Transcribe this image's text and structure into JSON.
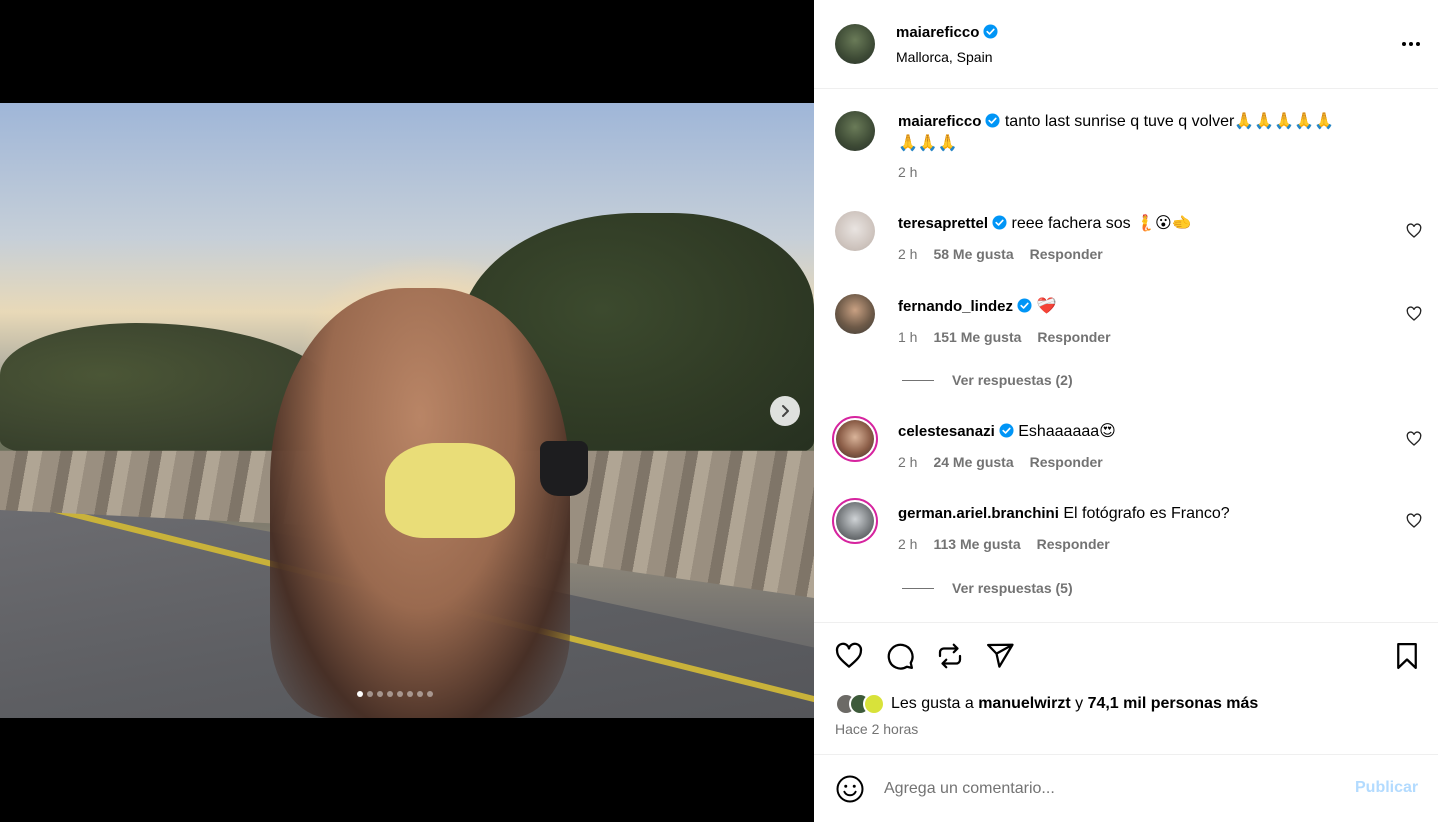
{
  "post": {
    "author": "maiareficco",
    "location": "Mallorca, Spain",
    "carousel": {
      "total_slides": 8,
      "active_index": 0
    }
  },
  "caption": {
    "author": "maiareficco",
    "text": "tanto last sunrise q tuve q volver🙏🙏🙏🙏🙏",
    "text_line2": "🙏🙏🙏",
    "time": "2 h"
  },
  "comments": [
    {
      "author": "teresaprettel",
      "text": "reee fachera sos 🧜😮🫲",
      "time": "2 h",
      "likes": "58 Me gusta",
      "reply": "Responder"
    },
    {
      "author": "fernando_lindez",
      "text": "❤️‍🩹",
      "time": "1 h",
      "likes": "151 Me gusta",
      "reply": "Responder",
      "view_replies": "Ver respuestas (2)"
    },
    {
      "author": "celestesanazi",
      "text": "Eshaaaaaa😍",
      "time": "2 h",
      "likes": "24 Me gusta",
      "reply": "Responder"
    },
    {
      "author": "german.ariel.branchini",
      "text": "El fotógrafo es Franco?",
      "time": "2 h",
      "likes": "113 Me gusta",
      "reply": "Responder",
      "view_replies": "Ver respuestas (5)"
    }
  ],
  "likes": {
    "prefix": "Les gusta a",
    "user": "manuelwirzt",
    "joiner": "y",
    "others": "74,1 mil personas más"
  },
  "time_ago": "Hace 2 horas",
  "composer": {
    "placeholder": "Agrega un comentario...",
    "publish_label": "Publicar"
  },
  "colors": {
    "verified": "#0095f6",
    "muted": "#737373",
    "publish_disabled": "#b3dbff"
  }
}
